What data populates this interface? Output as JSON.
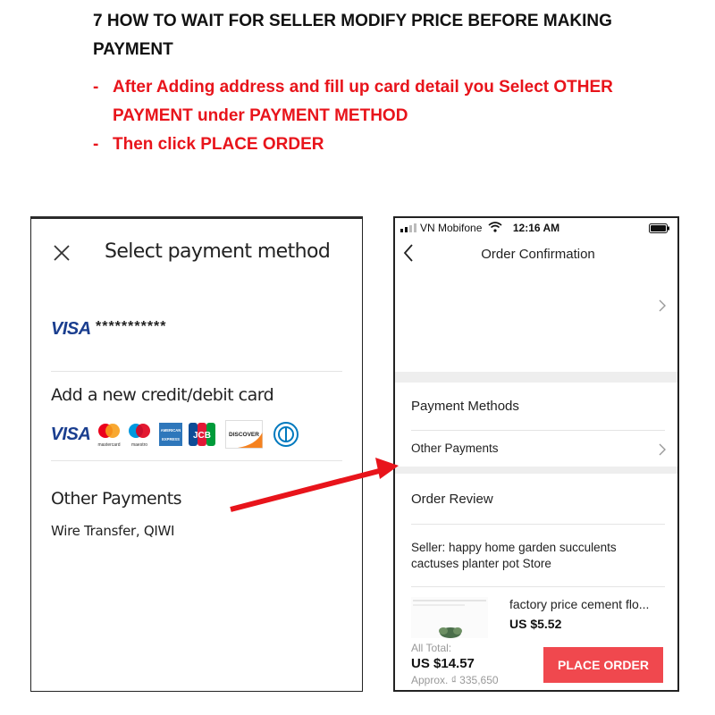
{
  "heading": "7 HOW TO WAIT FOR SELLER MODIFY PRICE BEFORE MAKING PAYMENT",
  "instructions": [
    {
      "dash": "-",
      "text": "After Adding address and fill up card detail you Select OTHER PAYMENT under PAYMENT METHOD"
    },
    {
      "dash": "-",
      "text": "Then click PLACE ORDER"
    }
  ],
  "left_screen": {
    "title": "Select payment method",
    "saved_card": {
      "brand": "VISA",
      "number": "***********"
    },
    "add_card_label": "Add a new credit/debit card",
    "card_brands": [
      {
        "name": "VISA",
        "icon": "visa-icon"
      },
      {
        "name": "mastercard",
        "icon": "mastercard-icon"
      },
      {
        "name": "maestro",
        "icon": "maestro-icon"
      },
      {
        "name": "AMERICAN EXPRESS",
        "icon": "amex-icon"
      },
      {
        "name": "JCB",
        "icon": "jcb-icon"
      },
      {
        "name": "DISCOVER",
        "icon": "discover-icon"
      },
      {
        "name": "Diners Club",
        "icon": "diners-icon"
      }
    ],
    "other_payments_label": "Other Payments",
    "other_payments_sub": "Wire Transfer, QIWI"
  },
  "right_screen": {
    "status_bar": {
      "carrier": "VN Mobifone",
      "time": "12:16 AM"
    },
    "nav_title": "Order Confirmation",
    "payment_methods_label": "Payment Methods",
    "other_payments_label": "Other Payments",
    "order_review_label": "Order Review",
    "seller_text": "Seller:  happy home garden succulents cactuses planter pot Store",
    "product": {
      "name": "factory price cement flo...",
      "price": "US $5.52"
    },
    "total": {
      "label": "All Total:",
      "amount": "US $14.57",
      "approx": "Approx. ₫ 335,650"
    },
    "place_order_label": "PLACE ORDER"
  },
  "colors": {
    "instruction_red": "#e8141b",
    "button_red": "#f0484e",
    "visa_blue": "#1a3e8f"
  }
}
